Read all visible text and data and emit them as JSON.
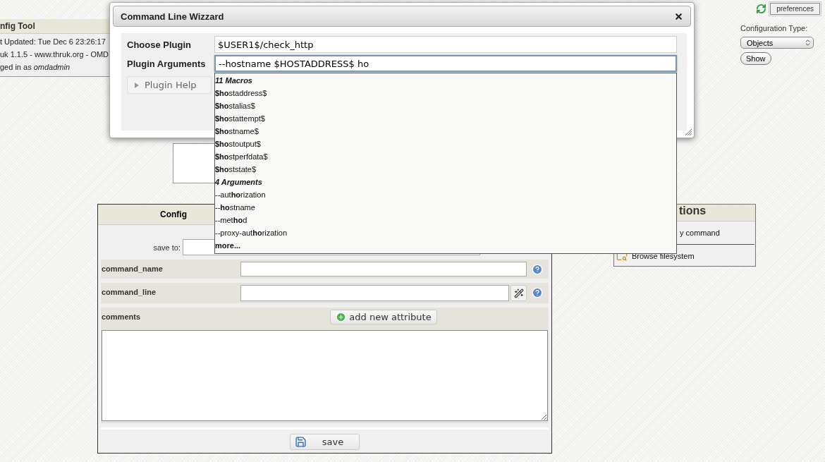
{
  "header": {
    "title": "nfig Tool",
    "lines": [
      "t Updated: Tue Dec 6 23:26:17",
      "uk 1.1.5 - www.thruk.org - OMD",
      "ged in as *omdadmin*"
    ]
  },
  "top_right": {
    "preferences": "preferences",
    "config_type_label": "Configuration Type:",
    "config_type_value": "Objects",
    "show": "Show"
  },
  "config": {
    "heading": "Config",
    "save_to_label": "save to:",
    "attributes": [
      {
        "kind": "text",
        "name": "command_name"
      },
      {
        "kind": "wizard",
        "name": "command_line"
      },
      {
        "kind": "textarea",
        "name": "comments"
      }
    ],
    "add_attribute": "add new attribute",
    "save": "save"
  },
  "actions": {
    "heading": "tions",
    "items": [
      "y command",
      "Browse filesystem"
    ]
  },
  "wizard": {
    "title": "Command Line Wizzard",
    "fields": [
      {
        "label": "Choose Plugin",
        "value": "$USER1$/check_http",
        "focused": false
      },
      {
        "label": "Plugin Arguments",
        "value": "--hostname $HOSTADDRESS$ ho",
        "focused": true
      }
    ],
    "help": "Plugin Help"
  },
  "autocomplete": {
    "items": [
      {
        "kind": "header",
        "text": "**11 Macros**"
      },
      {
        "kind": "item",
        "text": "**$ho**staddress$"
      },
      {
        "kind": "item",
        "text": "**$ho**stalias$"
      },
      {
        "kind": "item",
        "text": "**$ho**stattempt$"
      },
      {
        "kind": "item",
        "text": "**$ho**stname$"
      },
      {
        "kind": "item",
        "text": "**$ho**stoutput$"
      },
      {
        "kind": "item",
        "text": "**$ho**stperfdata$"
      },
      {
        "kind": "item",
        "text": "**$ho**ststate$"
      },
      {
        "kind": "header",
        "text": "**4 Arguments**"
      },
      {
        "kind": "item",
        "text": "--aut**ho**rization"
      },
      {
        "kind": "item",
        "text": "--**ho**stname"
      },
      {
        "kind": "item",
        "text": "--met**ho**d"
      },
      {
        "kind": "item",
        "text": "--proxy-aut**ho**rization"
      },
      {
        "kind": "more",
        "text": "**more...**"
      }
    ]
  }
}
